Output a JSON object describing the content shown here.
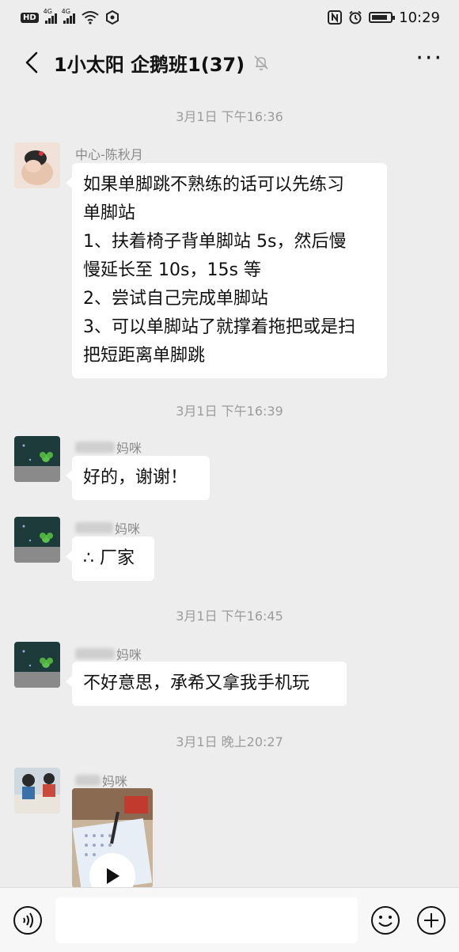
{
  "status": {
    "badge": "HD",
    "signal1_tag": "4G",
    "signal2_tag": "4G",
    "time": "10:29",
    "battery_level": 0.85
  },
  "header": {
    "title": "1小太阳 企鹅班1(37)",
    "back_icon": "chevron-left",
    "mute_icon": "bell-off",
    "more_icon": "ellipsis"
  },
  "messages": [
    {
      "type": "time",
      "text": "3月1日 下午16:36"
    },
    {
      "type": "text",
      "sender": "中心-陈秋月",
      "lines": [
        "如果单脚跳不熟练的话可以先练习",
        "单脚站",
        "1、扶着椅子背单脚站 5s，然后慢",
        "慢延长至 10s，15s 等",
        "2、尝试自己完成单脚站",
        "3、可以单脚站了就撑着拖把或是扫",
        "把短距离单脚跳"
      ]
    },
    {
      "type": "time",
      "text": "3月1日 下午16:39"
    },
    {
      "type": "text",
      "sender": "妈咪",
      "lines": [
        "好的，谢谢！"
      ]
    },
    {
      "type": "text",
      "sender": "妈咪",
      "lines": [
        "∴ 厂家"
      ]
    },
    {
      "type": "time",
      "text": "3月1日 下午16:45"
    },
    {
      "type": "text",
      "sender": "妈咪",
      "lines": [
        "不好意思，承希又拿我手机玩"
      ]
    },
    {
      "type": "time",
      "text": "3月1日 晚上20:27"
    },
    {
      "type": "video",
      "sender": "妈咪"
    }
  ],
  "input_bar": {
    "voice_icon": "voice",
    "emoji_icon": "smile",
    "plus_icon": "plus-circle",
    "input_value": ""
  }
}
